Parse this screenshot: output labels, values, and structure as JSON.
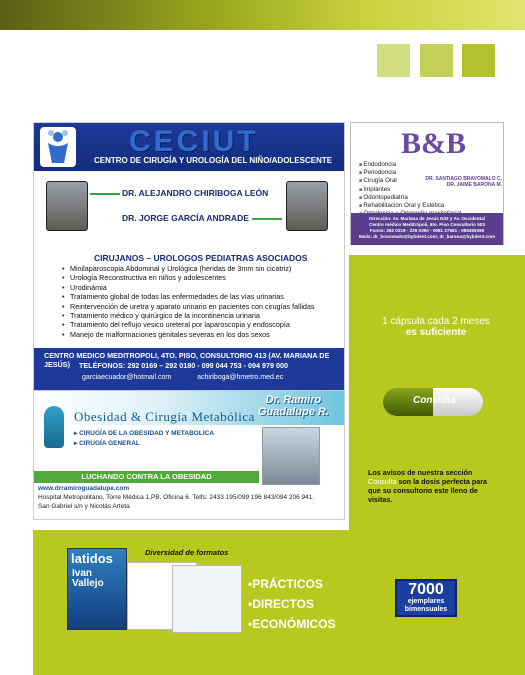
{
  "ceciut": {
    "title": "CECIUT",
    "subtitle": "CENTRO DE CIRUGÍA Y UROLOGÍA DEL NIÑO/ADOLESCENTE",
    "doctor1": "DR. ALEJANDRO CHIRIBOGA LEÓN",
    "doctor2": "DR. JORGE GARCÍA ANDRADE",
    "section_title": "CIRUJANOS – UROLOGOS PEDIATRAS ASOCIADOS",
    "services": [
      "Minilaparoscopia Abdominal y Urológica (heridas de 3mm sin cicatriz)",
      "Urología Reconstructiva en niños y adolescentes",
      "Urodinámia",
      "Tratamiento global de todas las enfermedades de las vías urinarias",
      "Reintervención de uretra y aparato urinario en pacientes con cirugías fallidas",
      "Tratamiento médico y quirúrgico de la incontinencia urinaria",
      "Tratamiento del reflujo vesico ureteral  por laparoscopia y endoscopía",
      "Manejo de malformaciones genitales severas en los dos sexos"
    ],
    "footer_address": "CENTRO MEDICO MEDITROPOLI, 4TO. PISO, CONSULTORIO 413 (AV. MARIANA DE JESÚS)",
    "footer_phones": "TELÉFONOS: 292 0169 – 292 0180 - 099 044 753 - 094 979 000",
    "email1": "garciaecuador@hotmail.com",
    "email2": "achiriboga@hmetro.med.ec"
  },
  "bb": {
    "logo": "B&B",
    "names_line1": "DR. SANTIAGO BRAVOMALO C.",
    "names_line2": "DR. JAIME BARONA M.",
    "services": [
      "Endodoncia",
      "Periodoncia",
      "Cirugía Oral",
      "Implantes",
      "Odontopediatría",
      "Rehabilitación Oral y Estética",
      "Ortodoncia y Ortopedia maxilofacial"
    ],
    "footer1": "Dirección: Av. Mariana de Jesús N32 y Av. Occidental",
    "footer2": "Centro médico Meditrópoli, 5to. Piso Consultorio 503",
    "footer3": "Fonos: 292 0219 - 226 0390 - 0981 27661 - 095296396",
    "footer4": "Mails: dr_bravomalo@bybdent.com; dr_barona@bybdent.com"
  },
  "ramiro": {
    "name_line1": "Dr. Ramiro",
    "name_line2": "Guadalupe R.",
    "brand": "Obesidad & Cirugía Metabólica",
    "bullet1": "CIRUGÍA DE LA OBESIDAD Y METABOLICA",
    "bullet2": "CIRUGÍA GENERAL",
    "band": "LUCHANDO CONTRA LA OBESIDAD",
    "website": "www.drramiroguadalupe.com",
    "address1": "Hospital Metropolitano, Torre Médica 1,PB, Oficina 6. Telfs: 2433 195/099 196 843/094 206 941.",
    "address2": "San Gabriel s/n y Nicolás Arteta"
  },
  "promo": {
    "line1": "1 cápsula cada 2 meses",
    "line2": "es suficiente",
    "pill_label": "Consulta",
    "text_a": "Los avisos de nuestra sección",
    "text_highlight": "Consulta",
    "text_b": "son la dosis perfecta para que su consultorio este lleno de visitas."
  },
  "bottom": {
    "magazine_title": "latidos",
    "magazine_cover_name1": "Ivan",
    "magazine_cover_name2": "Vallejo",
    "formats_caption": "Diversidad de formatos",
    "benefits": [
      "•PRÁCTICOS",
      "•DIRECTOS",
      "•ECONÓMICOS"
    ],
    "badge_number": "7000",
    "badge_line1": "ejemplares",
    "badge_line2": "bimensuales"
  },
  "colors": {
    "green": "#b9c81e",
    "navy": "#1d3a9a",
    "purple": "#5a3d8c"
  }
}
